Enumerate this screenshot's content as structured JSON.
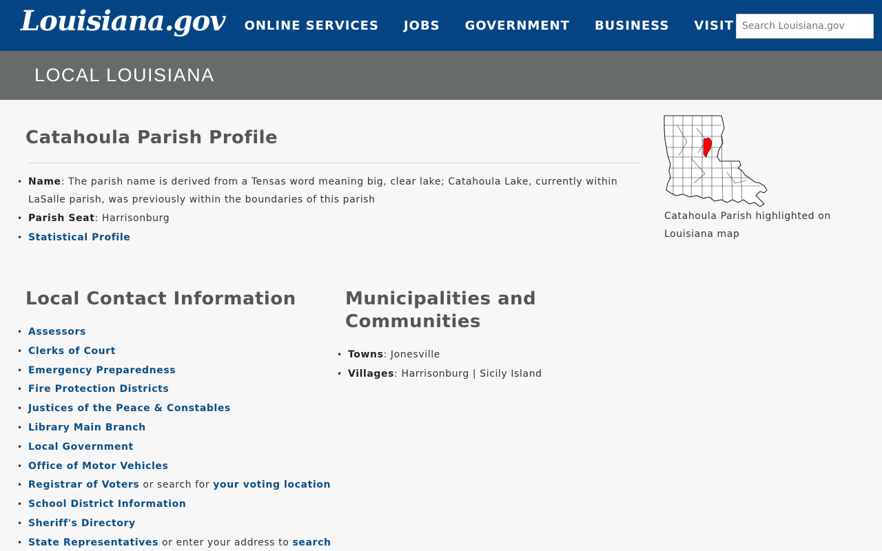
{
  "header": {
    "logo": "Louisiana.gov",
    "nav": [
      "ONLINE SERVICES",
      "JOBS",
      "GOVERNMENT",
      "BUSINESS",
      "VISIT"
    ],
    "search_placeholder": "Search Louisiana.gov"
  },
  "banner": {
    "title": "LOCAL LOUISIANA"
  },
  "profile": {
    "heading": "Catahoula Parish Profile",
    "name_label": "Name",
    "name_text": ": The parish name is derived from a Tensas word meaning big, clear lake; Catahoula Lake, currently within LaSalle parish, was previously within the boundaries of this parish",
    "seat_label": "Parish Seat",
    "seat_text": ": Harrisonburg",
    "stat_link": "Statistical Profile"
  },
  "map": {
    "caption": "Catahoula Parish highlighted on Louisiana map",
    "highlight_color": "#ff0000"
  },
  "contacts": {
    "heading": "Local Contact Information",
    "items": [
      "Assessors",
      "Clerks of Court",
      "Emergency Preparedness",
      "Fire Protection Districts",
      "Justices of the Peace & Constables",
      "Library Main Branch",
      "Local Government",
      "Office of Motor Vehicles"
    ],
    "registrar_link": "Registrar of Voters",
    "registrar_mid": " or search for ",
    "registrar_link2": "your voting location",
    "school": "School District Information",
    "sheriff": "Sheriff's Directory",
    "staterep_link": "State Representatives",
    "staterep_mid": " or enter your address to ",
    "staterep_link2": "search"
  },
  "municipalities": {
    "heading_line1": "Municipalities and",
    "heading_line2": "Communities",
    "towns_label": "Towns",
    "towns_text": ": Jonesville",
    "villages_label": "Villages",
    "villages_text": ": Harrisonburg | Sicily Island"
  }
}
